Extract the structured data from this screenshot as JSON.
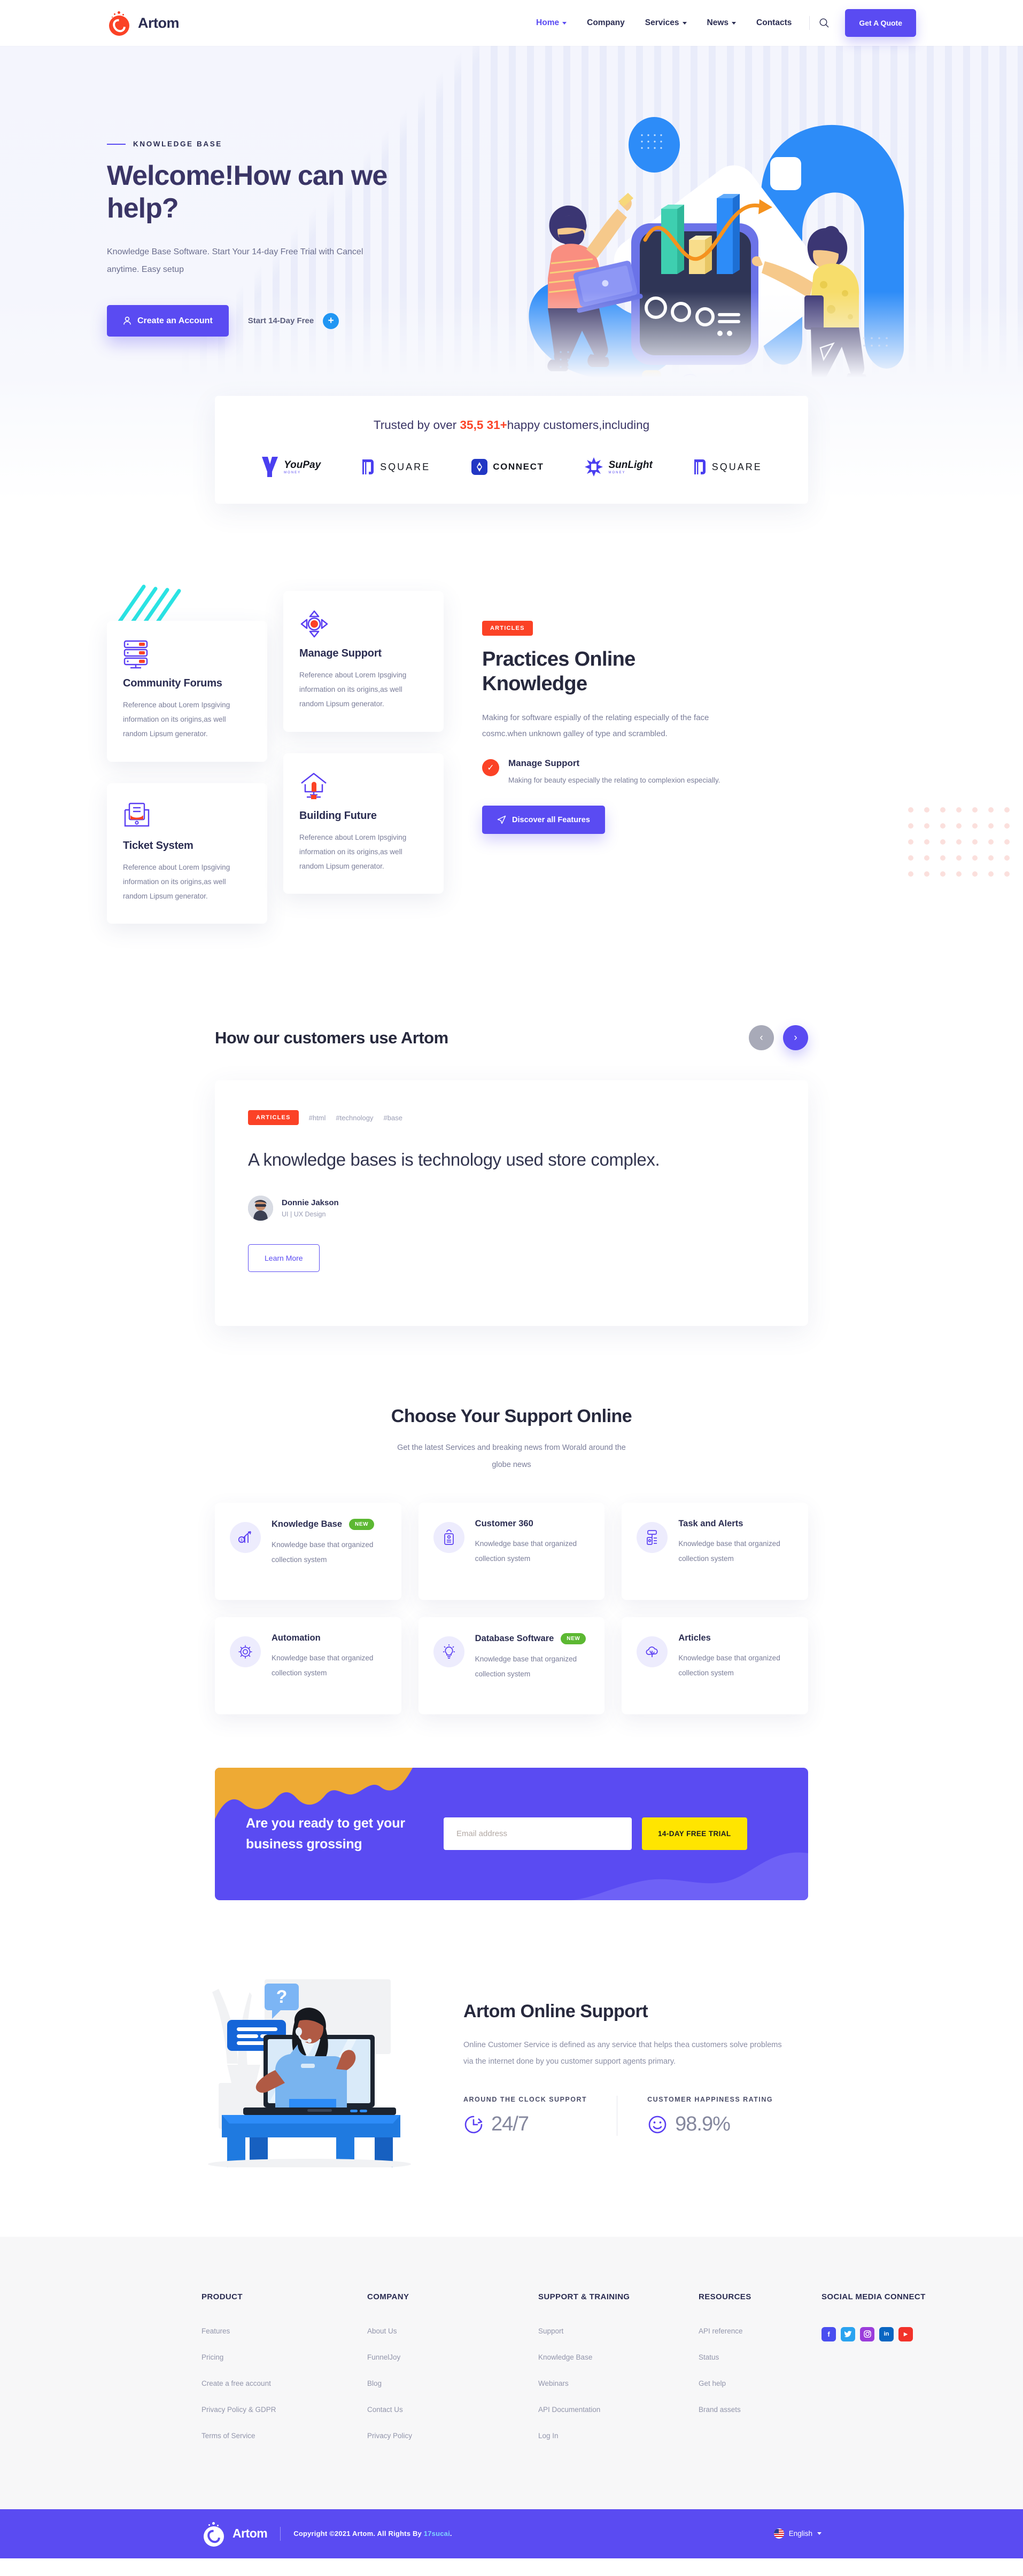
{
  "header": {
    "brand": "Artom",
    "nav": [
      {
        "label": "Home",
        "has_caret": true,
        "active": true
      },
      {
        "label": "Company",
        "has_caret": false,
        "active": false
      },
      {
        "label": "Services",
        "has_caret": true,
        "active": false
      },
      {
        "label": "News",
        "has_caret": true,
        "active": false
      },
      {
        "label": "Contacts",
        "has_caret": false,
        "active": false
      }
    ],
    "search_icon": "search-icon",
    "cta_label": "Get A Quote"
  },
  "hero": {
    "kicker": "KNOWLEDGE BASE",
    "title": "Welcome!How can we help?",
    "subtitle": "Knowledge Base Software. Start Your 14-day Free Trial with Cancel anytime. Easy setup",
    "primary_button": "Create an Account",
    "secondary_link": "Start 14-Day Free"
  },
  "trusted": {
    "prefix": "Trusted by over ",
    "count": "35,5 31+",
    "suffix": "happy customers,including",
    "logos": [
      {
        "name": "YouPay",
        "sub": "MONEY",
        "style": "youpay"
      },
      {
        "name": "SQUARE",
        "sub": "",
        "style": "square"
      },
      {
        "name": "CONNECT",
        "sub": "",
        "style": "connect"
      },
      {
        "name": "SunLight",
        "sub": "MONEY",
        "style": "sunlight"
      },
      {
        "name": "SQUARE",
        "sub": "",
        "style": "square"
      }
    ]
  },
  "features": {
    "cards": [
      {
        "icon": "server-rack-icon",
        "title": "Community Forums",
        "body": "Reference about Lorem Ipsgiving information on its origins,as well random Lipsum generator."
      },
      {
        "icon": "ticket-printer-icon",
        "title": "Ticket System",
        "body": "Reference about Lorem Ipsgiving information on its origins,as well random Lipsum generator."
      },
      {
        "icon": "move-target-icon",
        "title": "Manage Support",
        "body": "Reference about Lorem Ipsgiving information on its origins,as well random Lipsum generator."
      },
      {
        "icon": "house-network-icon",
        "title": "Building Future",
        "body": "Reference about Lorem Ipsgiving information on its origins,as well random Lipsum generator."
      }
    ],
    "panel": {
      "badge": "ARTICLES",
      "title": "Practices Online Knowledge",
      "body": "Making for software espially of the relating especially of the face cosmc.when unknown galley of type and scrambled.",
      "check_title": "Manage Support",
      "check_body": "Making for beauty especially the relating to complexion especially.",
      "button": "Discover all Features"
    }
  },
  "testimonial": {
    "heading": "How our customers use Artom",
    "prev_icon": "chevron-left-icon",
    "next_icon": "chevron-right-icon",
    "badge": "ARTICLES",
    "tags": [
      "#html",
      "#technology",
      "#base"
    ],
    "quote": "A knowledge bases is technology used store complex.",
    "author_name": "Donnie Jakson",
    "author_role": "UI | UX Design",
    "button": "Learn More"
  },
  "support": {
    "heading": "Choose Your Support Online",
    "lede": "Get the latest Services and breaking news from Worald around the globe news",
    "cards": [
      {
        "icon": "growth-chart-icon",
        "title": "Knowledge Base",
        "badge": "NEW",
        "body": "Knowledge base that organized collection system"
      },
      {
        "icon": "id-card-icon",
        "title": "Customer 360",
        "badge": "",
        "body": "Knowledge base that organized collection system"
      },
      {
        "icon": "alert-tower-icon",
        "title": "Task and Alerts",
        "badge": "",
        "body": "Knowledge base that organized collection system"
      },
      {
        "icon": "gear-icon",
        "title": "Automation",
        "badge": "",
        "body": "Knowledge base that organized collection system"
      },
      {
        "icon": "lightbulb-icon",
        "title": "Database Software",
        "badge": "NEW",
        "body": "Knowledge base that organized collection system"
      },
      {
        "icon": "cloud-plant-icon",
        "title": "Articles",
        "badge": "",
        "body": "Knowledge base that organized collection system"
      }
    ]
  },
  "cta_band": {
    "heading": "Are you ready to get your business grossing",
    "email_placeholder": "Email address",
    "button": "14-DAY FREE TRIAL"
  },
  "online_support": {
    "illustration": "customer-support-agent-illustration",
    "heading": "Artom Online Support",
    "body": "Online Customer Service is defined as any service that helps thea customers solve problems via the internet done by you customer support agents primary.",
    "stats": [
      {
        "label": "AROUND THE CLOCK SUPPORT",
        "value": "24/7",
        "icon": "clock-icon"
      },
      {
        "label": "CUSTOMER HAPPINESS RATING",
        "value": "98.9%",
        "icon": "smiley-icon"
      }
    ]
  },
  "footer": {
    "columns": [
      {
        "title": "PRODUCT",
        "links": [
          "Features",
          "Pricing",
          "Create a free account",
          "Privacy Policy & GDPR",
          "Terms of Service"
        ]
      },
      {
        "title": "COMPANY",
        "links": [
          "About Us",
          "FunnelJoy",
          "Blog",
          "Contact Us",
          "Privacy Policy"
        ]
      },
      {
        "title": "SUPPORT & TRAINING",
        "links": [
          "Support",
          "Knowledge Base",
          "Webinars",
          "API Documentation",
          "Log In"
        ]
      },
      {
        "title": "RESOURCES",
        "links": [
          "API reference",
          "Status",
          "Get help",
          "Brand assets"
        ]
      }
    ],
    "social_title": "SOCIAL MEDIA CONNECT",
    "socials": [
      {
        "name": "facebook-icon",
        "glyph": "f",
        "color": "#4a4ef0"
      },
      {
        "name": "twitter-icon",
        "glyph": "t",
        "color": "#2aa3f0"
      },
      {
        "name": "instagram-icon",
        "glyph": "o",
        "color": "#9b3ddb"
      },
      {
        "name": "linkedin-icon",
        "glyph": "in",
        "color": "#0a66c2"
      },
      {
        "name": "youtube-icon",
        "glyph": "▶",
        "color": "#f2322a"
      }
    ]
  },
  "bottom": {
    "brand": "Artom",
    "copyright_before": "Copyright ©2021 Artom. All Rights By ",
    "copyright_link": "17sucai",
    "copyright_after": ".",
    "language": "English"
  }
}
